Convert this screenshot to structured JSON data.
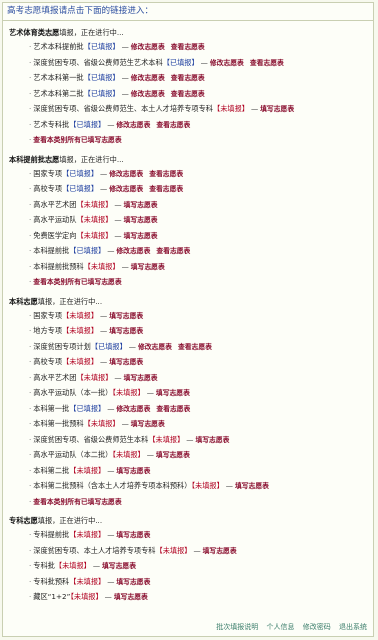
{
  "header": "高考志愿填报请点击下面的链接进入：",
  "statuses": {
    "done": "已填报",
    "todo": "未填报"
  },
  "links": {
    "modify": "修改志愿表",
    "view": "查看志愿表",
    "fill": "填写志愿表"
  },
  "all_link": "查看本类别所有已填写志愿表",
  "sections": [
    {
      "title": "艺术体育类志愿",
      "status_text": "填报，正在进行中...",
      "items": [
        {
          "name": "艺术本科提前批",
          "done": true
        },
        {
          "name": "深度贫困专项、省级公费师范生艺术本科",
          "done": true
        },
        {
          "name": "艺术本科第一批",
          "done": true
        },
        {
          "name": "艺术本科第二批",
          "done": true
        },
        {
          "name": "深度贫困专项、省级公费师范生、本土人才培养专项专科",
          "done": false
        },
        {
          "name": "艺术专科批",
          "done": true
        }
      ]
    },
    {
      "title": "本科提前批志愿",
      "status_text": "填报，正在进行中...",
      "items": [
        {
          "name": "国家专项",
          "done": true
        },
        {
          "name": "高校专项",
          "done": true
        },
        {
          "name": "高水平艺术团",
          "done": false
        },
        {
          "name": "高水平运动队",
          "done": false
        },
        {
          "name": "免费医学定向",
          "done": false
        },
        {
          "name": "本科提前批",
          "done": true
        },
        {
          "name": "本科提前批预科",
          "done": false
        }
      ]
    },
    {
      "title": "本科志愿",
      "status_text": "填报，正在进行中...",
      "items": [
        {
          "name": "国家专项",
          "done": false
        },
        {
          "name": "地方专项",
          "done": false
        },
        {
          "name": "深度贫困专项计划",
          "done": true
        },
        {
          "name": "高校专项",
          "done": false
        },
        {
          "name": "高水平艺术团",
          "done": false
        },
        {
          "name": "高水平运动队（本一批）",
          "done": false
        },
        {
          "name": "本科第一批",
          "done": true
        },
        {
          "name": "本科第一批预科",
          "done": false
        },
        {
          "name": "深度贫困专项、省级公费师范生本科",
          "done": false
        },
        {
          "name": "高水平运动队（本二批）",
          "done": false
        },
        {
          "name": "本科第二批",
          "done": false
        },
        {
          "name": "本科第二批预科（含本土人才培养专项本科预科）",
          "done": false
        }
      ]
    },
    {
      "title": "专科志愿",
      "status_text": "填报，正在进行中...",
      "items": [
        {
          "name": "专科提前批",
          "done": false
        },
        {
          "name": "深度贫困专项、本土人才培养专项专科",
          "done": false
        },
        {
          "name": "专科批",
          "done": false
        },
        {
          "name": "专科批预科",
          "done": false
        },
        {
          "name": "藏区“1+2”",
          "done": false
        }
      ]
    }
  ],
  "footer": [
    "批次填报说明",
    "个人信息",
    "修改密码",
    "退出系统"
  ]
}
